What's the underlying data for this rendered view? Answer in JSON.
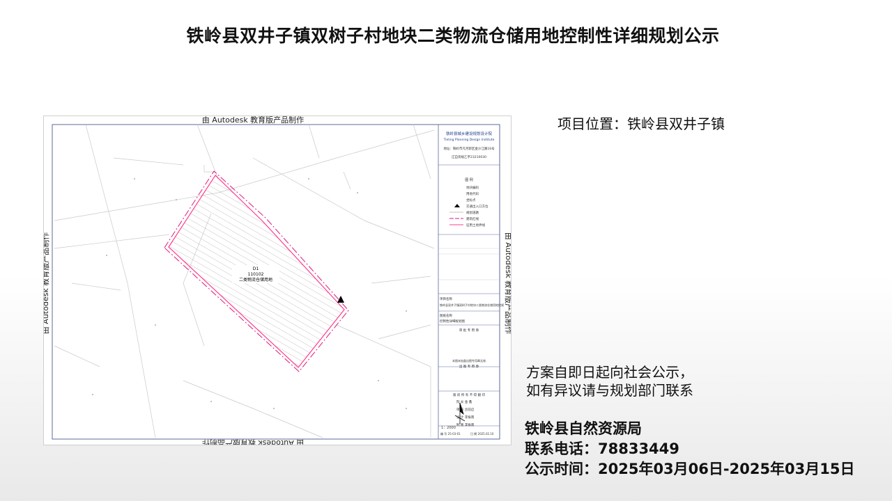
{
  "header": {
    "title": "铁岭县双井子镇双树子村地块二类物流仓储用地控制性详细规划公示"
  },
  "location": {
    "text": "项目位置：铁岭县双井子镇"
  },
  "notice": {
    "line1": "方案自即日起向社会公示，",
    "line2": "如有异议请与规划部门联系"
  },
  "info": {
    "agency": "铁岭县自然资源局",
    "phone_label": "联系电话：",
    "phone": "78833449",
    "period_label": "公示时间：",
    "period": "2025年03月06日-2025年03月15日"
  },
  "map": {
    "watermark": "由 Autodesk 教育版产品制作",
    "parcel_code": "D1",
    "land_code": "110102",
    "land_use": "二类物流仓储用地",
    "scale": "1：2000",
    "institute_name": "铁岭县城乡建设规划设计院",
    "institute_name_en": "Tieling Planning Design Institute",
    "institute_address": "地址：铁岭市凡河新区金沙江路16号",
    "institute_license": "辽自资规乙字23210030",
    "legend_title": "图   例",
    "legend_items": [
      "地块编码",
      "用地代码",
      "坐标点",
      "交通出入口方位",
      "规划道路",
      "建筑红线",
      "征用土地界线"
    ],
    "project_name_label": "项目名称",
    "project_name": "铁岭县双井子镇双树子村地块二类物流仓储用地控规",
    "drawing_name_label": "图纸名称",
    "drawing_name": "控制性详细规划图",
    "stamp_review": "审 批 专 用 章",
    "stamp_note": "本图未加盖出图专用章无效",
    "stamp_output": "出 图 专 用 章",
    "copyright": "版 权 所 有 不 得 翻 印",
    "signatures": [
      "院 长  金  鑫",
      "审  核  吕前启",
      "设  计  李振南",
      "制  图  李振南"
    ],
    "drawing_no": "编 号  25-03-01",
    "date": "日 期  2025.02.10",
    "colors": {
      "red_line": "#e0177a",
      "boundary": "#ff3c8c",
      "frame": "#5b6a9a",
      "hatch": "#8c8c8c"
    }
  }
}
